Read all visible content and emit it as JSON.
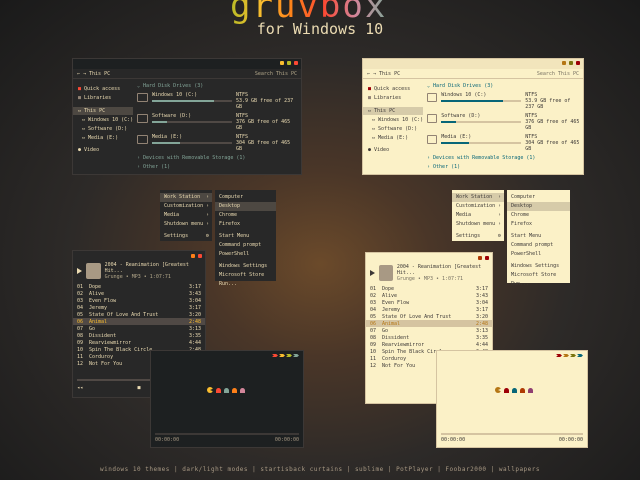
{
  "header": {
    "logo_text": "gruvbox",
    "subtitle": "for Windows 10"
  },
  "footer": {
    "text": "windows 10 themes | dark/light modes | startisback curtains | sublime | PotPlayer | Foobar2000 | wallpapers"
  },
  "colors": {
    "red": "#fb4934",
    "green": "#b8bb26",
    "yellow": "#fabd2f",
    "blue": "#83a598",
    "purple": "#d3869b",
    "aqua": "#8ec07c",
    "orange": "#fe8019",
    "dark_bg": "#282828",
    "light_bg": "#fbf1c7"
  },
  "explorer": {
    "path": "This PC",
    "search_placeholder": "Search This PC",
    "sidebar": [
      "Quick access",
      "Libraries",
      "This PC",
      "Windows 10 (C:)",
      "Software (D:)",
      "Media (E:)",
      "Video"
    ],
    "section_hdd_dark": "Hard Disk Drives (3)",
    "section_hdd_light": "Hard Disk Drives (3)",
    "drives": [
      {
        "name": "Windows 10 (C:)",
        "fs": "NTFS",
        "free": "53.9 GB free of 237 GB",
        "used": 0.77
      },
      {
        "name": "Software (D:)",
        "fs": "NTFS",
        "free": "376 GB free of 465 GB",
        "used": 0.19
      },
      {
        "name": "Media (E:)",
        "fs": "NTFS",
        "free": "304 GB free of 465 GB",
        "used": 0.35
      }
    ],
    "section_removable": "Devices with Removable Storage (1)",
    "section_other": "Other (1)"
  },
  "start_menu": {
    "left": [
      "Work Station",
      "Customization",
      "Media",
      "Shutdown menu",
      "Settings"
    ],
    "right": [
      "Computer",
      "Desktop",
      "Chrome",
      "Firefox",
      "Start Menu",
      "Command prompt",
      "PowerShell",
      "Windows Settings",
      "Microsoft Store",
      "Run..."
    ]
  },
  "player": {
    "now_playing": "2004 - Reanimation [Greatest Hit...",
    "meta": "Grunge • MP3 • 1:07:71",
    "tracks": [
      {
        "n": "01",
        "t": "Dope",
        "d": "3:17"
      },
      {
        "n": "02",
        "t": "Alive",
        "d": "3:43"
      },
      {
        "n": "03",
        "t": "Even Flow",
        "d": "3:04"
      },
      {
        "n": "04",
        "t": "Jeremy",
        "d": "3:17"
      },
      {
        "n": "05",
        "t": "State Of Love And Trust",
        "d": "3:20"
      },
      {
        "n": "06",
        "t": "Animal",
        "d": "2:48"
      },
      {
        "n": "07",
        "t": "Go",
        "d": "3:13"
      },
      {
        "n": "08",
        "t": "Dissident",
        "d": "3:35"
      },
      {
        "n": "09",
        "t": "Rearviewmirror",
        "d": "4:44"
      },
      {
        "n": "10",
        "t": "Spin The Black Circle",
        "d": "2:48"
      },
      {
        "n": "11",
        "t": "Corduroy",
        "d": "4:37"
      },
      {
        "n": "12",
        "t": "Not For You",
        "d": "5:52"
      }
    ],
    "current_index": 5,
    "time_left": "00:00:00",
    "time_right": "00:00:00"
  }
}
